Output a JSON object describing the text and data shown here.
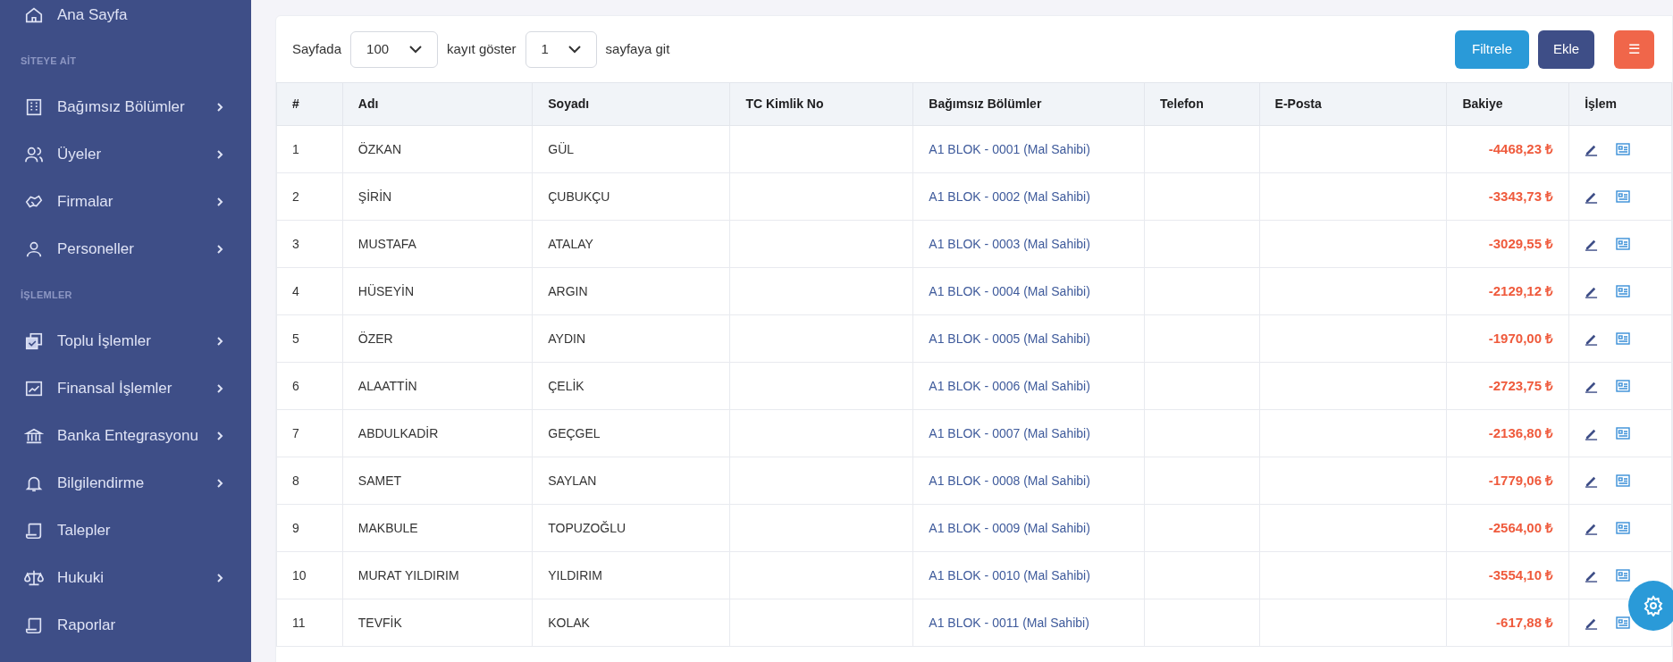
{
  "sidebar": {
    "items": [
      {
        "kind": "link",
        "label": "Ana Sayfa",
        "has_submenu": false
      },
      {
        "kind": "heading",
        "label": "SİTEYE AİT"
      },
      {
        "kind": "link",
        "label": "Bağımsız Bölümler",
        "has_submenu": true
      },
      {
        "kind": "link",
        "label": "Üyeler",
        "has_submenu": true
      },
      {
        "kind": "link",
        "label": "Firmalar",
        "has_submenu": true
      },
      {
        "kind": "link",
        "label": "Personeller",
        "has_submenu": true
      },
      {
        "kind": "heading",
        "label": "İŞLEMLER"
      },
      {
        "kind": "link",
        "label": "Toplu İşlemler",
        "has_submenu": true
      },
      {
        "kind": "link",
        "label": "Finansal İşlemler",
        "has_submenu": true
      },
      {
        "kind": "link",
        "label": "Banka Entegrasyonu",
        "has_submenu": true
      },
      {
        "kind": "link",
        "label": "Bilgilendirme",
        "has_submenu": true
      },
      {
        "kind": "link",
        "label": "Talepler",
        "has_submenu": false
      },
      {
        "kind": "link",
        "label": "Hukuki",
        "has_submenu": true
      },
      {
        "kind": "link",
        "label": "Raporlar",
        "has_submenu": false
      }
    ]
  },
  "toolbar": {
    "per_page_label": "Sayfada",
    "per_page_value": "100",
    "records_label": "kayıt göster",
    "page_value": "1",
    "page_label": "sayfaya git",
    "buttons": [
      {
        "kind": "filter",
        "label": "Filtrele"
      },
      {
        "kind": "add",
        "label": "Ekle"
      },
      {
        "kind": "menu",
        "label": "☰"
      }
    ]
  },
  "table": {
    "columns": [
      "#",
      "Adı",
      "Soyadı",
      "TC Kimlik No",
      "Bağımsız Bölümler",
      "Telefon",
      "E-Posta",
      "Bakiye",
      "İşlem"
    ],
    "rows": [
      {
        "no": "1",
        "name": "ÖZKAN",
        "surname": "GÜL",
        "tc": "",
        "unit": "A1 BLOK - 0001 (Mal Sahibi)",
        "phone": "",
        "email": "",
        "balance": "-4468,23 ₺"
      },
      {
        "no": "2",
        "name": "ŞİRİN",
        "surname": "ÇUBUKÇU",
        "tc": "",
        "unit": "A1 BLOK - 0002 (Mal Sahibi)",
        "phone": "",
        "email": "",
        "balance": "-3343,73 ₺"
      },
      {
        "no": "3",
        "name": "MUSTAFA",
        "surname": "ATALAY",
        "tc": "",
        "unit": "A1 BLOK - 0003 (Mal Sahibi)",
        "phone": "",
        "email": "",
        "balance": "-3029,55 ₺"
      },
      {
        "no": "4",
        "name": "HÜSEYİN",
        "surname": "ARGIN",
        "tc": "",
        "unit": "A1 BLOK - 0004 (Mal Sahibi)",
        "phone": "",
        "email": "",
        "balance": "-2129,12 ₺"
      },
      {
        "no": "5",
        "name": "ÖZER",
        "surname": "AYDIN",
        "tc": "",
        "unit": "A1 BLOK - 0005 (Mal Sahibi)",
        "phone": "",
        "email": "",
        "balance": "-1970,00 ₺"
      },
      {
        "no": "6",
        "name": "ALAATTİN",
        "surname": "ÇELİK",
        "tc": "",
        "unit": "A1 BLOK - 0006 (Mal Sahibi)",
        "phone": "",
        "email": "",
        "balance": "-2723,75 ₺"
      },
      {
        "no": "7",
        "name": "ABDULKADİR",
        "surname": "GEÇGEL",
        "tc": "",
        "unit": "A1 BLOK - 0007 (Mal Sahibi)",
        "phone": "",
        "email": "",
        "balance": "-2136,80 ₺"
      },
      {
        "no": "8",
        "name": "SAMET",
        "surname": "SAYLAN",
        "tc": "",
        "unit": "A1 BLOK - 0008 (Mal Sahibi)",
        "phone": "",
        "email": "",
        "balance": "-1779,06 ₺"
      },
      {
        "no": "9",
        "name": "MAKBULE",
        "surname": "TOPUZOĞLU",
        "tc": "",
        "unit": "A1 BLOK - 0009 (Mal Sahibi)",
        "phone": "",
        "email": "",
        "balance": "-2564,00 ₺"
      },
      {
        "no": "10",
        "name": "MURAT YILDIRIM",
        "surname": "YILDIRIM",
        "tc": "",
        "unit": "A1 BLOK - 0010 (Mal Sahibi)",
        "phone": "",
        "email": "",
        "balance": "-3554,10 ₺"
      },
      {
        "no": "11",
        "name": "TEVFİK",
        "surname": "KOLAK",
        "tc": "",
        "unit": "A1 BLOK - 0011 (Mal Sahibi)",
        "phone": "",
        "email": "",
        "balance": "-617,88 ₺"
      }
    ]
  }
}
